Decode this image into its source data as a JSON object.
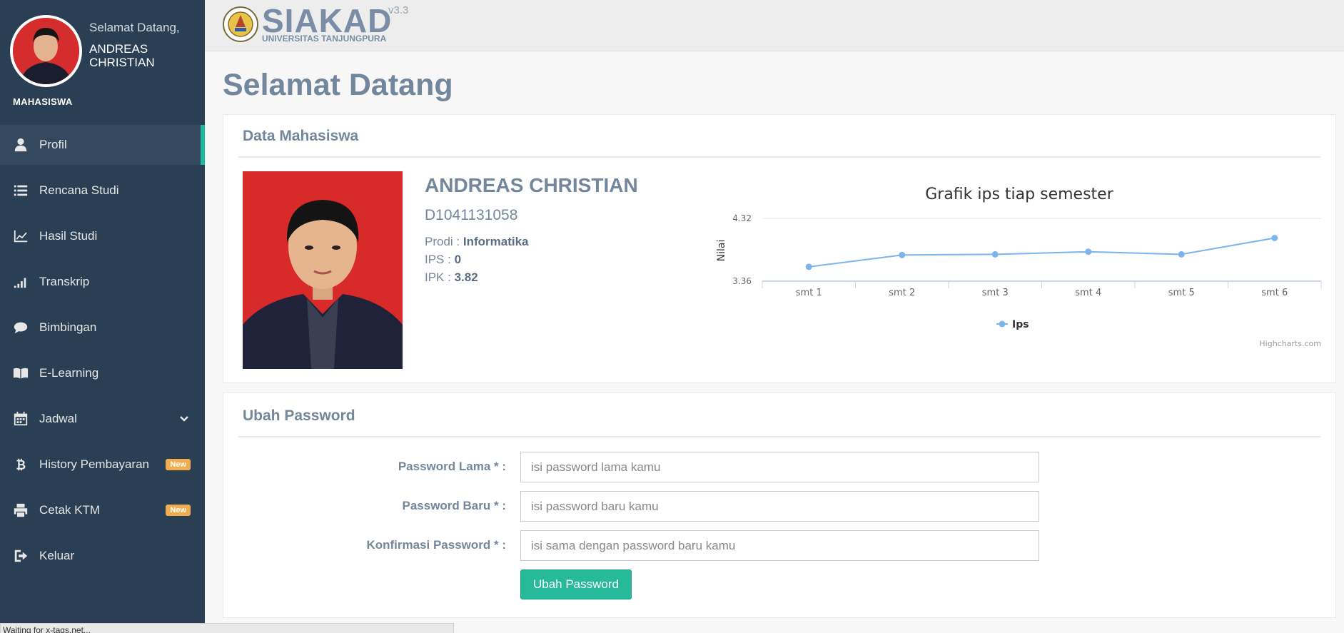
{
  "sidebar": {
    "welcome": "Selamat Datang,",
    "username": "ANDREAS CHRISTIAN",
    "role": "MAHASISWA",
    "items": [
      {
        "label": "Profil",
        "icon": "user-icon",
        "active": true
      },
      {
        "label": "Rencana Studi",
        "icon": "list-icon"
      },
      {
        "label": "Hasil Studi",
        "icon": "line-chart-icon"
      },
      {
        "label": "Transkrip",
        "icon": "signal-bars-icon"
      },
      {
        "label": "Bimbingan",
        "icon": "comment-icon"
      },
      {
        "label": "E-Learning",
        "icon": "book-icon"
      },
      {
        "label": "Jadwal",
        "icon": "calendar-icon",
        "has_dropdown": true
      },
      {
        "label": "History Pembayaran",
        "icon": "bitcoin-icon",
        "badge": "New"
      },
      {
        "label": "Cetak KTM",
        "icon": "print-icon",
        "badge": "New"
      },
      {
        "label": "Keluar",
        "icon": "sign-out-icon"
      }
    ]
  },
  "topbar": {
    "brand": "SIAKAD",
    "version": "v3.3",
    "university": "UNIVERSITAS TANJUNGPURA"
  },
  "page": {
    "title": "Selamat Datang"
  },
  "student_panel": {
    "title": "Data Mahasiswa",
    "name": "ANDREAS CHRISTIAN",
    "nim": "D1041131058",
    "prodi_label": "Prodi : ",
    "prodi_value": "Informatika",
    "ips_label": "IPS : ",
    "ips_value": "0",
    "ipk_label": "IPK : ",
    "ipk_value": "3.82"
  },
  "chart_data": {
    "type": "line",
    "title": "Grafik ips tiap semester",
    "xlabel": "",
    "ylabel": "Nilai",
    "categories": [
      "smt 1",
      "smt 2",
      "smt 3",
      "smt 4",
      "smt 5",
      "smt 6"
    ],
    "series": [
      {
        "name": "Ips",
        "values": [
          3.58,
          3.76,
          3.77,
          3.81,
          3.77,
          4.02
        ]
      }
    ],
    "ylim": [
      3.36,
      4.32
    ],
    "yticks": [
      "4.32",
      "3.36"
    ],
    "legend": "bottom-center",
    "credit": "Highcharts.com",
    "color": "#7cb5ec"
  },
  "password_panel": {
    "title": "Ubah Password",
    "old_label": "Password Lama * :",
    "old_placeholder": "isi password lama kamu",
    "new_label": "Password Baru * :",
    "new_placeholder": "isi password baru kamu",
    "confirm_label": "Konfirmasi Password * :",
    "confirm_placeholder": "isi sama dengan password baru kamu",
    "submit": "Ubah Password"
  },
  "statusbar": {
    "text": "Waiting for x-tags.net..."
  },
  "colors": {
    "sidebar": "#2a3f54",
    "accent": "#1abb9c",
    "button": "#26b99a",
    "badge": "#f0ad4e"
  }
}
